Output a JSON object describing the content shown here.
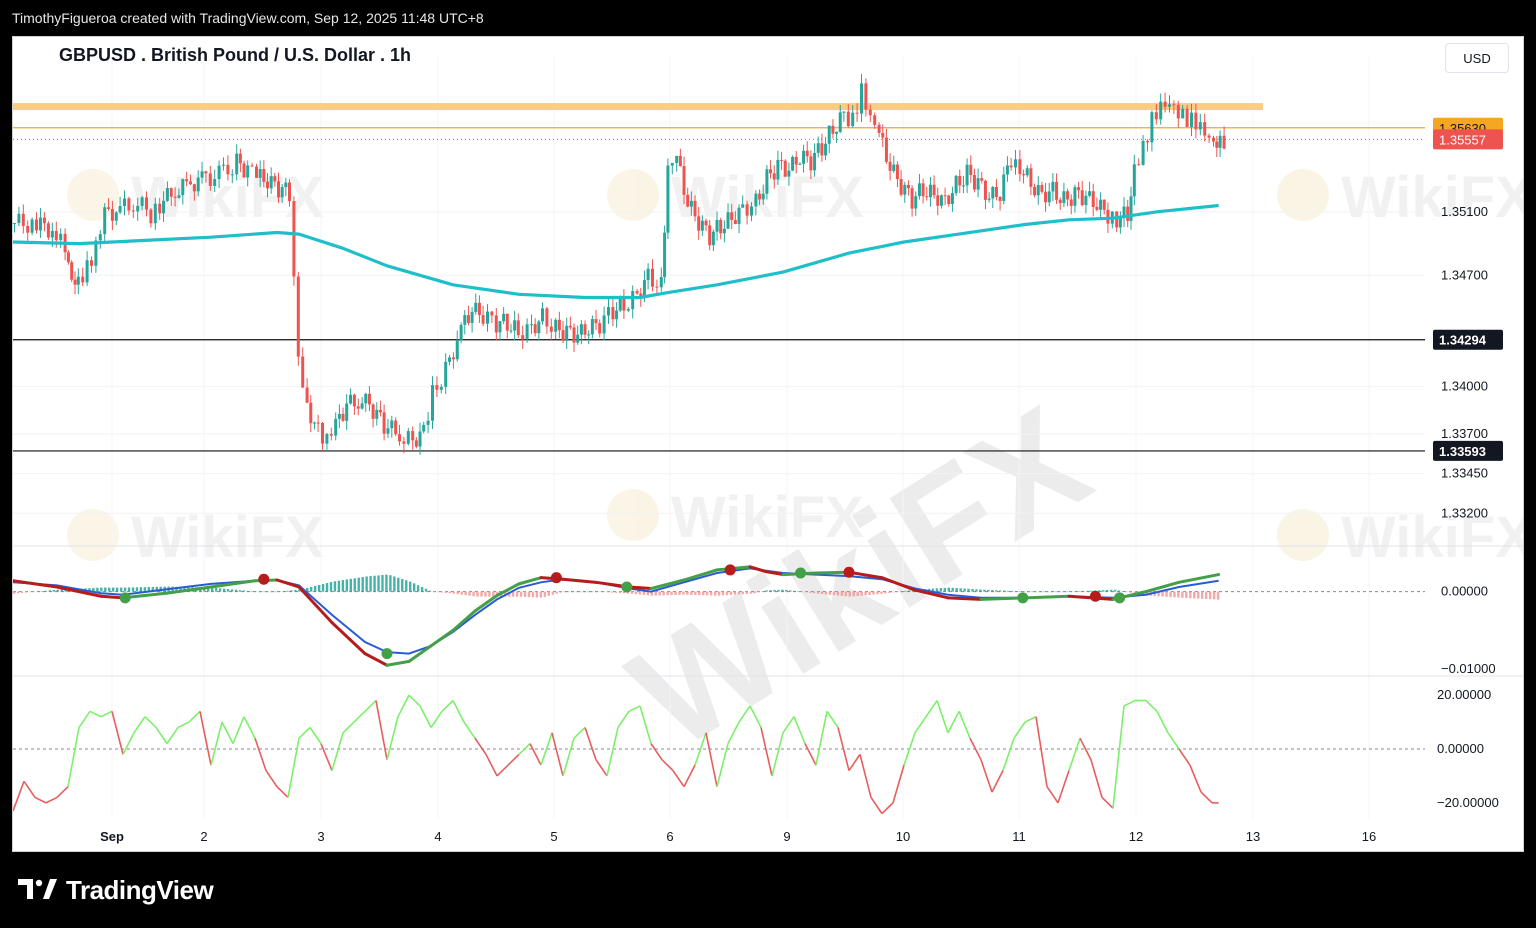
{
  "header": {
    "attribution": "TimothyFigueroa created with TradingView.com, Sep 12, 2025 11:48 UTC+8"
  },
  "chart_title": "GBPUSD . British Pound / U.S. Dollar . 1h",
  "currency": "USD",
  "footer": {
    "brand": "TradingView"
  },
  "watermark": {
    "text": "WikiFX"
  },
  "colors": {
    "up": "#26a69a",
    "down": "#ef5350",
    "ema": "#1fbfca",
    "resistance_band": "#fbc77b",
    "macd_fast": "#2a5bd7",
    "macd_slow": "#b71c1c",
    "macd_green": "#43a047",
    "osc_up": "#7cf06a",
    "osc_down": "#e85d5d"
  },
  "chart_data": {
    "type": "candlestick",
    "symbol": "GBPUSD",
    "timeframe": "1h",
    "x_ticks": [
      "Sep",
      "2",
      "3",
      "4",
      "5",
      "6",
      "9",
      "10",
      "11",
      "12",
      "13",
      "16"
    ],
    "price_axis": {
      "ylim": [
        1.33,
        1.3595
      ],
      "ticks": [
        "1.35100",
        "1.34700",
        "1.34000",
        "1.33700",
        "1.33450",
        "1.33200"
      ],
      "tick_values": [
        1.351,
        1.347,
        1.34,
        1.337,
        1.3345,
        1.332
      ]
    },
    "price_labels": [
      {
        "text": "1.35630",
        "value": 1.3563,
        "style": "orange"
      },
      {
        "text": "1.35557",
        "value": 1.35557,
        "style": "red"
      },
      {
        "text": "1.34294",
        "value": 1.34294,
        "style": "black"
      },
      {
        "text": "1.33593",
        "value": 1.33593,
        "style": "black"
      }
    ],
    "horizontal_lines": [
      {
        "value": 1.35767,
        "type": "resistance-band"
      },
      {
        "value": 1.3563,
        "type": "orange-line"
      },
      {
        "value": 1.34294,
        "type": "support"
      },
      {
        "value": 1.33593,
        "type": "support"
      }
    ],
    "close_path": [
      [
        0.0,
        1.3503
      ],
      [
        1.0,
        1.3502
      ],
      [
        1.9,
        1.3498
      ],
      [
        2.3,
        1.349
      ],
      [
        2.6,
        1.347
      ],
      [
        2.9,
        1.3468
      ],
      [
        3.3,
        1.3475
      ],
      [
        3.7,
        1.3486
      ],
      [
        4.1,
        1.3508
      ],
      [
        4.8,
        1.3512
      ],
      [
        5.6,
        1.3516
      ],
      [
        6.2,
        1.3508
      ],
      [
        6.6,
        1.3515
      ],
      [
        7.3,
        1.3523
      ],
      [
        8.0,
        1.3528
      ],
      [
        8.7,
        1.3531
      ],
      [
        9.5,
        1.3534
      ],
      [
        10.1,
        1.3541
      ],
      [
        10.6,
        1.3536
      ],
      [
        11.0,
        1.3532
      ],
      [
        11.5,
        1.3529
      ],
      [
        12.0,
        1.3525
      ],
      [
        12.5,
        1.3522
      ],
      [
        12.9,
        1.3421
      ],
      [
        13.3,
        1.3388
      ],
      [
        13.8,
        1.3372
      ],
      [
        14.2,
        1.3364
      ],
      [
        14.6,
        1.3375
      ],
      [
        15.1,
        1.3388
      ],
      [
        15.8,
        1.3392
      ],
      [
        16.3,
        1.3385
      ],
      [
        16.8,
        1.3376
      ],
      [
        17.5,
        1.3369
      ],
      [
        18.1,
        1.3366
      ],
      [
        18.6,
        1.3372
      ],
      [
        19.0,
        1.3395
      ],
      [
        19.6,
        1.341
      ],
      [
        20.3,
        1.3436
      ],
      [
        20.8,
        1.3448
      ],
      [
        21.3,
        1.3444
      ],
      [
        21.9,
        1.344
      ],
      [
        22.4,
        1.344
      ],
      [
        22.9,
        1.3434
      ],
      [
        23.5,
        1.3437
      ],
      [
        24.0,
        1.3444
      ],
      [
        24.6,
        1.3436
      ],
      [
        25.1,
        1.3434
      ],
      [
        25.6,
        1.3432
      ],
      [
        26.1,
        1.3436
      ],
      [
        26.6,
        1.3439
      ],
      [
        27.2,
        1.3448
      ],
      [
        27.7,
        1.3451
      ],
      [
        28.3,
        1.3458
      ],
      [
        28.8,
        1.347
      ],
      [
        29.4,
        1.3463
      ],
      [
        29.7,
        1.3534
      ],
      [
        30.1,
        1.3543
      ],
      [
        30.6,
        1.3515
      ],
      [
        31.1,
        1.3503
      ],
      [
        31.6,
        1.3495
      ],
      [
        32.1,
        1.3501
      ],
      [
        32.6,
        1.3506
      ],
      [
        33.1,
        1.3512
      ],
      [
        33.7,
        1.3516
      ],
      [
        34.2,
        1.3531
      ],
      [
        34.7,
        1.3539
      ],
      [
        35.2,
        1.3536
      ],
      [
        35.7,
        1.3544
      ],
      [
        36.2,
        1.3542
      ],
      [
        36.7,
        1.3551
      ],
      [
        37.2,
        1.3562
      ],
      [
        37.7,
        1.3572
      ],
      [
        38.1,
        1.3568
      ],
      [
        38.5,
        1.3585
      ],
      [
        38.9,
        1.3566
      ],
      [
        39.3,
        1.3558
      ],
      [
        39.8,
        1.3538
      ],
      [
        40.3,
        1.3526
      ],
      [
        40.8,
        1.3518
      ],
      [
        41.3,
        1.3524
      ],
      [
        41.8,
        1.3521
      ],
      [
        42.3,
        1.3517
      ],
      [
        42.8,
        1.3527
      ],
      [
        43.3,
        1.3534
      ],
      [
        43.8,
        1.3528
      ],
      [
        44.3,
        1.3519
      ],
      [
        44.8,
        1.3521
      ],
      [
        45.3,
        1.3544
      ],
      [
        45.7,
        1.3539
      ],
      [
        46.2,
        1.3528
      ],
      [
        46.7,
        1.3521
      ],
      [
        47.2,
        1.3524
      ],
      [
        47.7,
        1.3517
      ],
      [
        48.2,
        1.3521
      ],
      [
        48.7,
        1.3519
      ],
      [
        49.2,
        1.3514
      ],
      [
        49.7,
        1.3508
      ],
      [
        50.1,
        1.3506
      ],
      [
        50.6,
        1.3508
      ],
      [
        50.9,
        1.354
      ],
      [
        51.3,
        1.3551
      ],
      [
        51.7,
        1.3567
      ],
      [
        52.1,
        1.3574
      ],
      [
        52.5,
        1.3575
      ],
      [
        52.9,
        1.357
      ],
      [
        53.3,
        1.3568
      ],
      [
        53.7,
        1.3568
      ],
      [
        54.1,
        1.3563
      ],
      [
        54.5,
        1.3556
      ],
      [
        54.8,
        1.35557
      ]
    ],
    "ema_path": [
      [
        0.0,
        1.3491
      ],
      [
        3.0,
        1.349
      ],
      [
        6.0,
        1.3492
      ],
      [
        9.0,
        1.3494
      ],
      [
        12.0,
        1.3497
      ],
      [
        13.0,
        1.3496
      ],
      [
        15.0,
        1.3487
      ],
      [
        17.0,
        1.3476
      ],
      [
        20.0,
        1.3464
      ],
      [
        23.0,
        1.3458
      ],
      [
        26.0,
        1.3456
      ],
      [
        28.5,
        1.3456
      ],
      [
        29.7,
        1.3459
      ],
      [
        32.0,
        1.3464
      ],
      [
        35.0,
        1.3472
      ],
      [
        38.0,
        1.3484
      ],
      [
        40.5,
        1.3491
      ],
      [
        43.0,
        1.3496
      ],
      [
        46.0,
        1.3502
      ],
      [
        48.0,
        1.3505
      ],
      [
        50.0,
        1.3506
      ],
      [
        52.0,
        1.351
      ],
      [
        54.8,
        1.3514
      ]
    ],
    "macd": {
      "ylim": [
        -0.0105,
        0.0055
      ],
      "ticks": [
        "0.00000",
        "−0.01000"
      ],
      "tick_values": [
        0.0,
        -0.01
      ],
      "fast": [
        [
          0.0,
          0.0012
        ],
        [
          2.0,
          0.0008
        ],
        [
          4.0,
          -0.0002
        ],
        [
          5.0,
          -0.0004
        ],
        [
          7.0,
          0.0003
        ],
        [
          9.0,
          0.001
        ],
        [
          11.0,
          0.0014
        ],
        [
          12.0,
          0.0015
        ],
        [
          13.0,
          0.0008
        ],
        [
          14.5,
          -0.003
        ],
        [
          16.0,
          -0.0065
        ],
        [
          17.0,
          -0.0078
        ],
        [
          18.0,
          -0.008
        ],
        [
          19.0,
          -0.007
        ],
        [
          20.0,
          -0.0052
        ],
        [
          21.0,
          -0.003
        ],
        [
          22.0,
          -0.001
        ],
        [
          23.0,
          0.0005
        ],
        [
          24.0,
          0.0012
        ],
        [
          25.0,
          0.0016
        ],
        [
          26.5,
          0.0012
        ],
        [
          28.0,
          0.0004
        ],
        [
          29.0,
          0.0
        ],
        [
          30.5,
          0.0012
        ],
        [
          32.0,
          0.0024
        ],
        [
          33.5,
          0.003
        ],
        [
          35.0,
          0.0024
        ],
        [
          36.5,
          0.0022
        ],
        [
          38.0,
          0.002
        ],
        [
          39.5,
          0.0016
        ],
        [
          41.0,
          0.0004
        ],
        [
          42.5,
          -0.0004
        ],
        [
          44.0,
          -0.0008
        ],
        [
          46.0,
          -0.0008
        ],
        [
          48.0,
          -0.0006
        ],
        [
          50.0,
          -0.0008
        ],
        [
          51.5,
          -0.0004
        ],
        [
          53.0,
          0.0006
        ],
        [
          54.8,
          0.0014
        ]
      ],
      "slow": [
        [
          0.0,
          0.0014
        ],
        [
          2.0,
          0.0006
        ],
        [
          4.0,
          -0.0006
        ],
        [
          5.0,
          -0.0008
        ],
        [
          7.0,
          -0.0002
        ],
        [
          9.0,
          0.0006
        ],
        [
          11.0,
          0.0014
        ],
        [
          12.0,
          0.0015
        ],
        [
          13.0,
          0.0006
        ],
        [
          14.5,
          -0.004
        ],
        [
          16.0,
          -0.008
        ],
        [
          17.0,
          -0.0095
        ],
        [
          18.0,
          -0.009
        ],
        [
          19.0,
          -0.007
        ],
        [
          20.0,
          -0.005
        ],
        [
          21.0,
          -0.0025
        ],
        [
          22.0,
          -0.0005
        ],
        [
          23.0,
          0.001
        ],
        [
          24.0,
          0.0018
        ],
        [
          25.0,
          0.0016
        ],
        [
          26.5,
          0.0012
        ],
        [
          28.0,
          0.0006
        ],
        [
          29.0,
          0.0004
        ],
        [
          30.5,
          0.0015
        ],
        [
          32.0,
          0.0028
        ],
        [
          33.5,
          0.0032
        ],
        [
          34.2,
          0.0026
        ],
        [
          35.0,
          0.0022
        ],
        [
          36.5,
          0.0024
        ],
        [
          38.0,
          0.0025
        ],
        [
          39.5,
          0.0018
        ],
        [
          41.0,
          0.0002
        ],
        [
          42.5,
          -0.0008
        ],
        [
          44.0,
          -0.001
        ],
        [
          46.0,
          -0.0008
        ],
        [
          48.0,
          -0.0006
        ],
        [
          50.0,
          -0.001
        ],
        [
          51.5,
          0.0
        ],
        [
          53.0,
          0.0012
        ],
        [
          54.8,
          0.0022
        ]
      ],
      "green_markers": [
        [
          5.1,
          -0.0008
        ],
        [
          17.0,
          -0.008
        ],
        [
          27.9,
          0.0006
        ],
        [
          35.8,
          0.0024
        ],
        [
          45.9,
          -0.0008
        ],
        [
          50.3,
          -0.0008
        ]
      ],
      "red_markers": [
        [
          11.4,
          0.0016
        ],
        [
          24.7,
          0.0018
        ],
        [
          32.6,
          0.0028
        ],
        [
          38.0,
          0.0025
        ],
        [
          49.2,
          -0.0006
        ]
      ]
    },
    "oscillator": {
      "ylim": [
        -26,
        26
      ],
      "ticks": [
        "20.00000",
        "0.00000",
        "−20.00000"
      ],
      "tick_values": [
        20,
        0,
        -20
      ],
      "path": [
        [
          0.0,
          -23
        ],
        [
          0.5,
          -12
        ],
        [
          1.0,
          -18
        ],
        [
          1.5,
          -20
        ],
        [
          2.0,
          -18
        ],
        [
          2.5,
          -14
        ],
        [
          3.0,
          8
        ],
        [
          3.5,
          14
        ],
        [
          4.0,
          12
        ],
        [
          4.5,
          14
        ],
        [
          5.0,
          -2
        ],
        [
          5.5,
          6
        ],
        [
          6.0,
          12
        ],
        [
          6.5,
          8
        ],
        [
          7.0,
          2
        ],
        [
          7.5,
          8
        ],
        [
          8.0,
          10
        ],
        [
          8.5,
          14
        ],
        [
          9.0,
          -6
        ],
        [
          9.5,
          10
        ],
        [
          10.0,
          2
        ],
        [
          10.5,
          12
        ],
        [
          11.0,
          4
        ],
        [
          11.5,
          -8
        ],
        [
          12.0,
          -14
        ],
        [
          12.5,
          -18
        ],
        [
          13.0,
          4
        ],
        [
          13.5,
          8
        ],
        [
          14.0,
          2
        ],
        [
          14.5,
          -8
        ],
        [
          15.0,
          6
        ],
        [
          15.5,
          10
        ],
        [
          16.0,
          14
        ],
        [
          16.5,
          18
        ],
        [
          17.0,
          -4
        ],
        [
          17.5,
          12
        ],
        [
          18.0,
          20
        ],
        [
          18.5,
          16
        ],
        [
          19.0,
          8
        ],
        [
          19.5,
          14
        ],
        [
          20.0,
          18
        ],
        [
          20.5,
          10
        ],
        [
          21.0,
          4
        ],
        [
          21.5,
          -2
        ],
        [
          22.0,
          -10
        ],
        [
          22.5,
          -6
        ],
        [
          23.0,
          -2
        ],
        [
          23.5,
          2
        ],
        [
          24.0,
          -6
        ],
        [
          24.5,
          6
        ],
        [
          25.0,
          -10
        ],
        [
          25.5,
          4
        ],
        [
          26.0,
          8
        ],
        [
          26.5,
          -4
        ],
        [
          27.0,
          -10
        ],
        [
          27.5,
          8
        ],
        [
          28.0,
          14
        ],
        [
          28.5,
          16
        ],
        [
          29.0,
          2
        ],
        [
          29.5,
          -4
        ],
        [
          30.0,
          -8
        ],
        [
          30.5,
          -14
        ],
        [
          31.0,
          -6
        ],
        [
          31.5,
          6
        ],
        [
          32.0,
          -14
        ],
        [
          32.5,
          2
        ],
        [
          33.0,
          10
        ],
        [
          33.5,
          16
        ],
        [
          34.0,
          8
        ],
        [
          34.5,
          -10
        ],
        [
          35.0,
          6
        ],
        [
          35.5,
          12
        ],
        [
          36.0,
          2
        ],
        [
          36.5,
          -6
        ],
        [
          37.0,
          14
        ],
        [
          37.5,
          8
        ],
        [
          38.0,
          -8
        ],
        [
          38.5,
          -2
        ],
        [
          39.0,
          -18
        ],
        [
          39.5,
          -24
        ],
        [
          40.0,
          -20
        ],
        [
          40.5,
          -6
        ],
        [
          41.0,
          6
        ],
        [
          41.5,
          12
        ],
        [
          42.0,
          18
        ],
        [
          42.5,
          6
        ],
        [
          43.0,
          14
        ],
        [
          43.5,
          4
        ],
        [
          44.0,
          -4
        ],
        [
          44.5,
          -16
        ],
        [
          45.0,
          -8
        ],
        [
          45.5,
          4
        ],
        [
          46.0,
          10
        ],
        [
          46.5,
          12
        ],
        [
          47.0,
          -14
        ],
        [
          47.5,
          -20
        ],
        [
          48.0,
          -8
        ],
        [
          48.5,
          4
        ],
        [
          49.0,
          -4
        ],
        [
          49.5,
          -18
        ],
        [
          50.0,
          -22
        ],
        [
          50.5,
          16
        ],
        [
          51.0,
          18
        ],
        [
          51.5,
          18
        ],
        [
          52.0,
          14
        ],
        [
          52.5,
          6
        ],
        [
          53.0,
          0
        ],
        [
          53.5,
          -6
        ],
        [
          54.0,
          -16
        ],
        [
          54.5,
          -20
        ],
        [
          54.8,
          -20
        ]
      ]
    }
  }
}
